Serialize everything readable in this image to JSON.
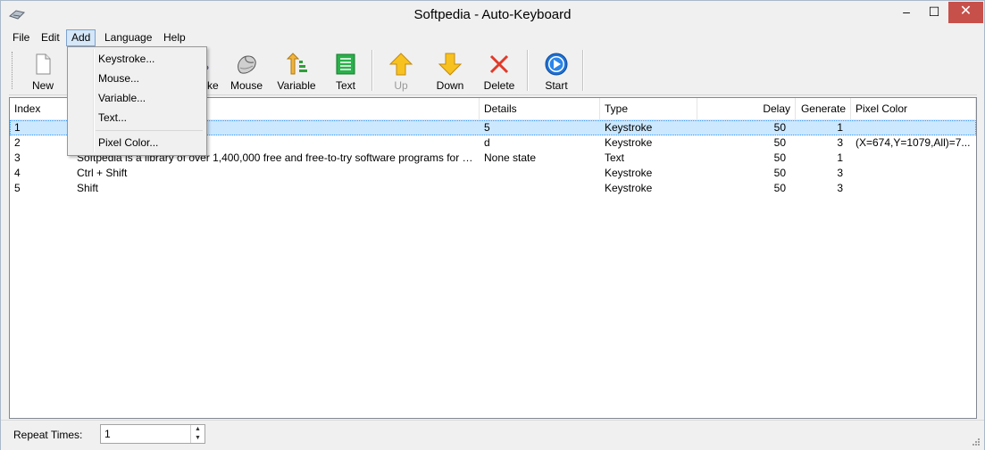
{
  "window": {
    "title": "Softpedia - Auto-Keyboard",
    "minimize": "–",
    "maximize": "☐",
    "close": "✕"
  },
  "menu": {
    "file": "File",
    "edit": "Edit",
    "add": "Add",
    "language": "Language",
    "help": "Help"
  },
  "add_menu": {
    "keystroke": "Keystroke...",
    "mouse": "Mouse...",
    "variable": "Variable...",
    "text": "Text...",
    "pixel_color": "Pixel Color..."
  },
  "toolbar": {
    "new": "New",
    "keystroke_partial": "roke",
    "mouse": "Mouse",
    "variable": "Variable",
    "text": "Text",
    "up": "Up",
    "down": "Down",
    "delete": "Delete",
    "start": "Start"
  },
  "table": {
    "headers": {
      "index": "Index",
      "details": "Details",
      "type": "Type",
      "delay": "Delay",
      "generate": "Generate",
      "pixel_color": "Pixel Color"
    },
    "rows": [
      {
        "index": "1",
        "name": "",
        "details": "5",
        "type": "Keystroke",
        "delay": "50",
        "generate": "1",
        "pixel_color": ""
      },
      {
        "index": "2",
        "name": "",
        "details": "d",
        "type": "Keystroke",
        "delay": "50",
        "generate": "3",
        "pixel_color": "(X=674,Y=1079,All)=7..."
      },
      {
        "index": "3",
        "name": "Softpedia is a library of over 1,400,000 free and free-to-try software programs for Wind...",
        "details": "None state",
        "type": "Text",
        "delay": "50",
        "generate": "1",
        "pixel_color": ""
      },
      {
        "index": "4",
        "name": "Ctrl + Shift",
        "details": "",
        "type": "Keystroke",
        "delay": "50",
        "generate": "3",
        "pixel_color": ""
      },
      {
        "index": "5",
        "name": "Shift",
        "details": "",
        "type": "Keystroke",
        "delay": "50",
        "generate": "3",
        "pixel_color": ""
      }
    ]
  },
  "status": {
    "repeat_label": "Repeat Times:",
    "repeat_value": "1"
  },
  "colors": {
    "selection": "#cce8ff",
    "close_button": "#c7504a",
    "menu_highlight": "#d5e7f8"
  }
}
